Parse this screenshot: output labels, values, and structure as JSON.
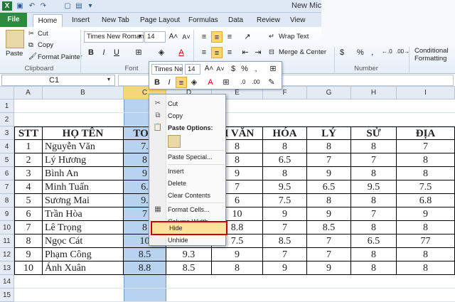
{
  "window": {
    "title": "New Micro"
  },
  "tabs": [
    "File",
    "Home",
    "Insert",
    "New Tab",
    "Page Layout",
    "Formulas",
    "Data",
    "Review",
    "View"
  ],
  "ribbon": {
    "clipboard": {
      "paste": "Paste",
      "cut": "Cut",
      "copy": "Copy",
      "format_painter": "Format Painter",
      "label": "Clipboard"
    },
    "font": {
      "name": "Times New Roman",
      "size": "14",
      "label": "Font"
    },
    "alignment": {
      "wrap_text": "Wrap Text",
      "merge_center": "Merge & Center"
    },
    "number": {
      "currency": "$",
      "percent": "%",
      "comma": ",",
      "label": "Number"
    },
    "styles": {
      "conditional": "Conditional",
      "formatting": "Formatting"
    }
  },
  "formula_bar": {
    "name_box": "C1",
    "fx": "fx"
  },
  "columns": [
    "A",
    "B",
    "C",
    "D",
    "E",
    "F",
    "G",
    "H",
    "I"
  ],
  "rows": [
    "1",
    "2",
    "3",
    "4",
    "5",
    "6",
    "7",
    "8",
    "9",
    "10",
    "11",
    "12",
    "13",
    "14",
    "15"
  ],
  "table": {
    "headers": [
      "STT",
      "HỌ TÊN",
      "TOÁ",
      "",
      "H VĂN",
      "HÓA",
      "LÝ",
      "SỬ",
      "ĐỊA"
    ],
    "rows": [
      [
        "1",
        "Nguyễn Văn",
        "7.",
        "",
        "8",
        "8",
        "8",
        "8",
        "7"
      ],
      [
        "2",
        "Lý Hương",
        "8",
        "",
        "8",
        "6.5",
        "7",
        "7",
        "8"
      ],
      [
        "3",
        "Bình An",
        "9",
        "",
        "9",
        "8",
        "9",
        "8",
        "8"
      ],
      [
        "4",
        "Minh Tuấn",
        "6.",
        "",
        "7",
        "9.5",
        "6.5",
        "9.5",
        "7.5"
      ],
      [
        "5",
        "Sương Mai",
        "9.",
        "",
        "6",
        "7.5",
        "8",
        "8",
        "6.8"
      ],
      [
        "6",
        "Trần Hòa",
        "7",
        "",
        "10",
        "9",
        "9",
        "7",
        "9"
      ],
      [
        "7",
        "Lê Trọng",
        "8",
        "",
        "8.8",
        "7",
        "8.5",
        "8",
        "8"
      ],
      [
        "8",
        "Ngọc Cát",
        "10",
        "",
        "7.5",
        "8.5",
        "7",
        "6.5",
        "77"
      ],
      [
        "9",
        "Phạm Công",
        "8.5",
        "9.3",
        "9",
        "7",
        "7",
        "8",
        "8"
      ],
      [
        "10",
        "Ánh Xuân",
        "8.8",
        "8.5",
        "8",
        "9",
        "9",
        "8",
        "8"
      ]
    ]
  },
  "mini_toolbar": {
    "font": "Times Ne",
    "size": "14"
  },
  "context_menu": {
    "cut": "Cut",
    "copy": "Copy",
    "paste_options": "Paste Options:",
    "paste_special": "Paste Special...",
    "insert": "Insert",
    "delete": "Delete",
    "clear_contents": "Clear Contents",
    "format_cells": "Format Cells...",
    "column_width": "Column Width...",
    "hide": "Hide",
    "unhide": "Unhide"
  },
  "colors": {
    "file_tab": "#2e8b3e",
    "selected_column": "#b7d3ef",
    "highlight": "#fbe39b",
    "hide_border": "#cc0000"
  }
}
